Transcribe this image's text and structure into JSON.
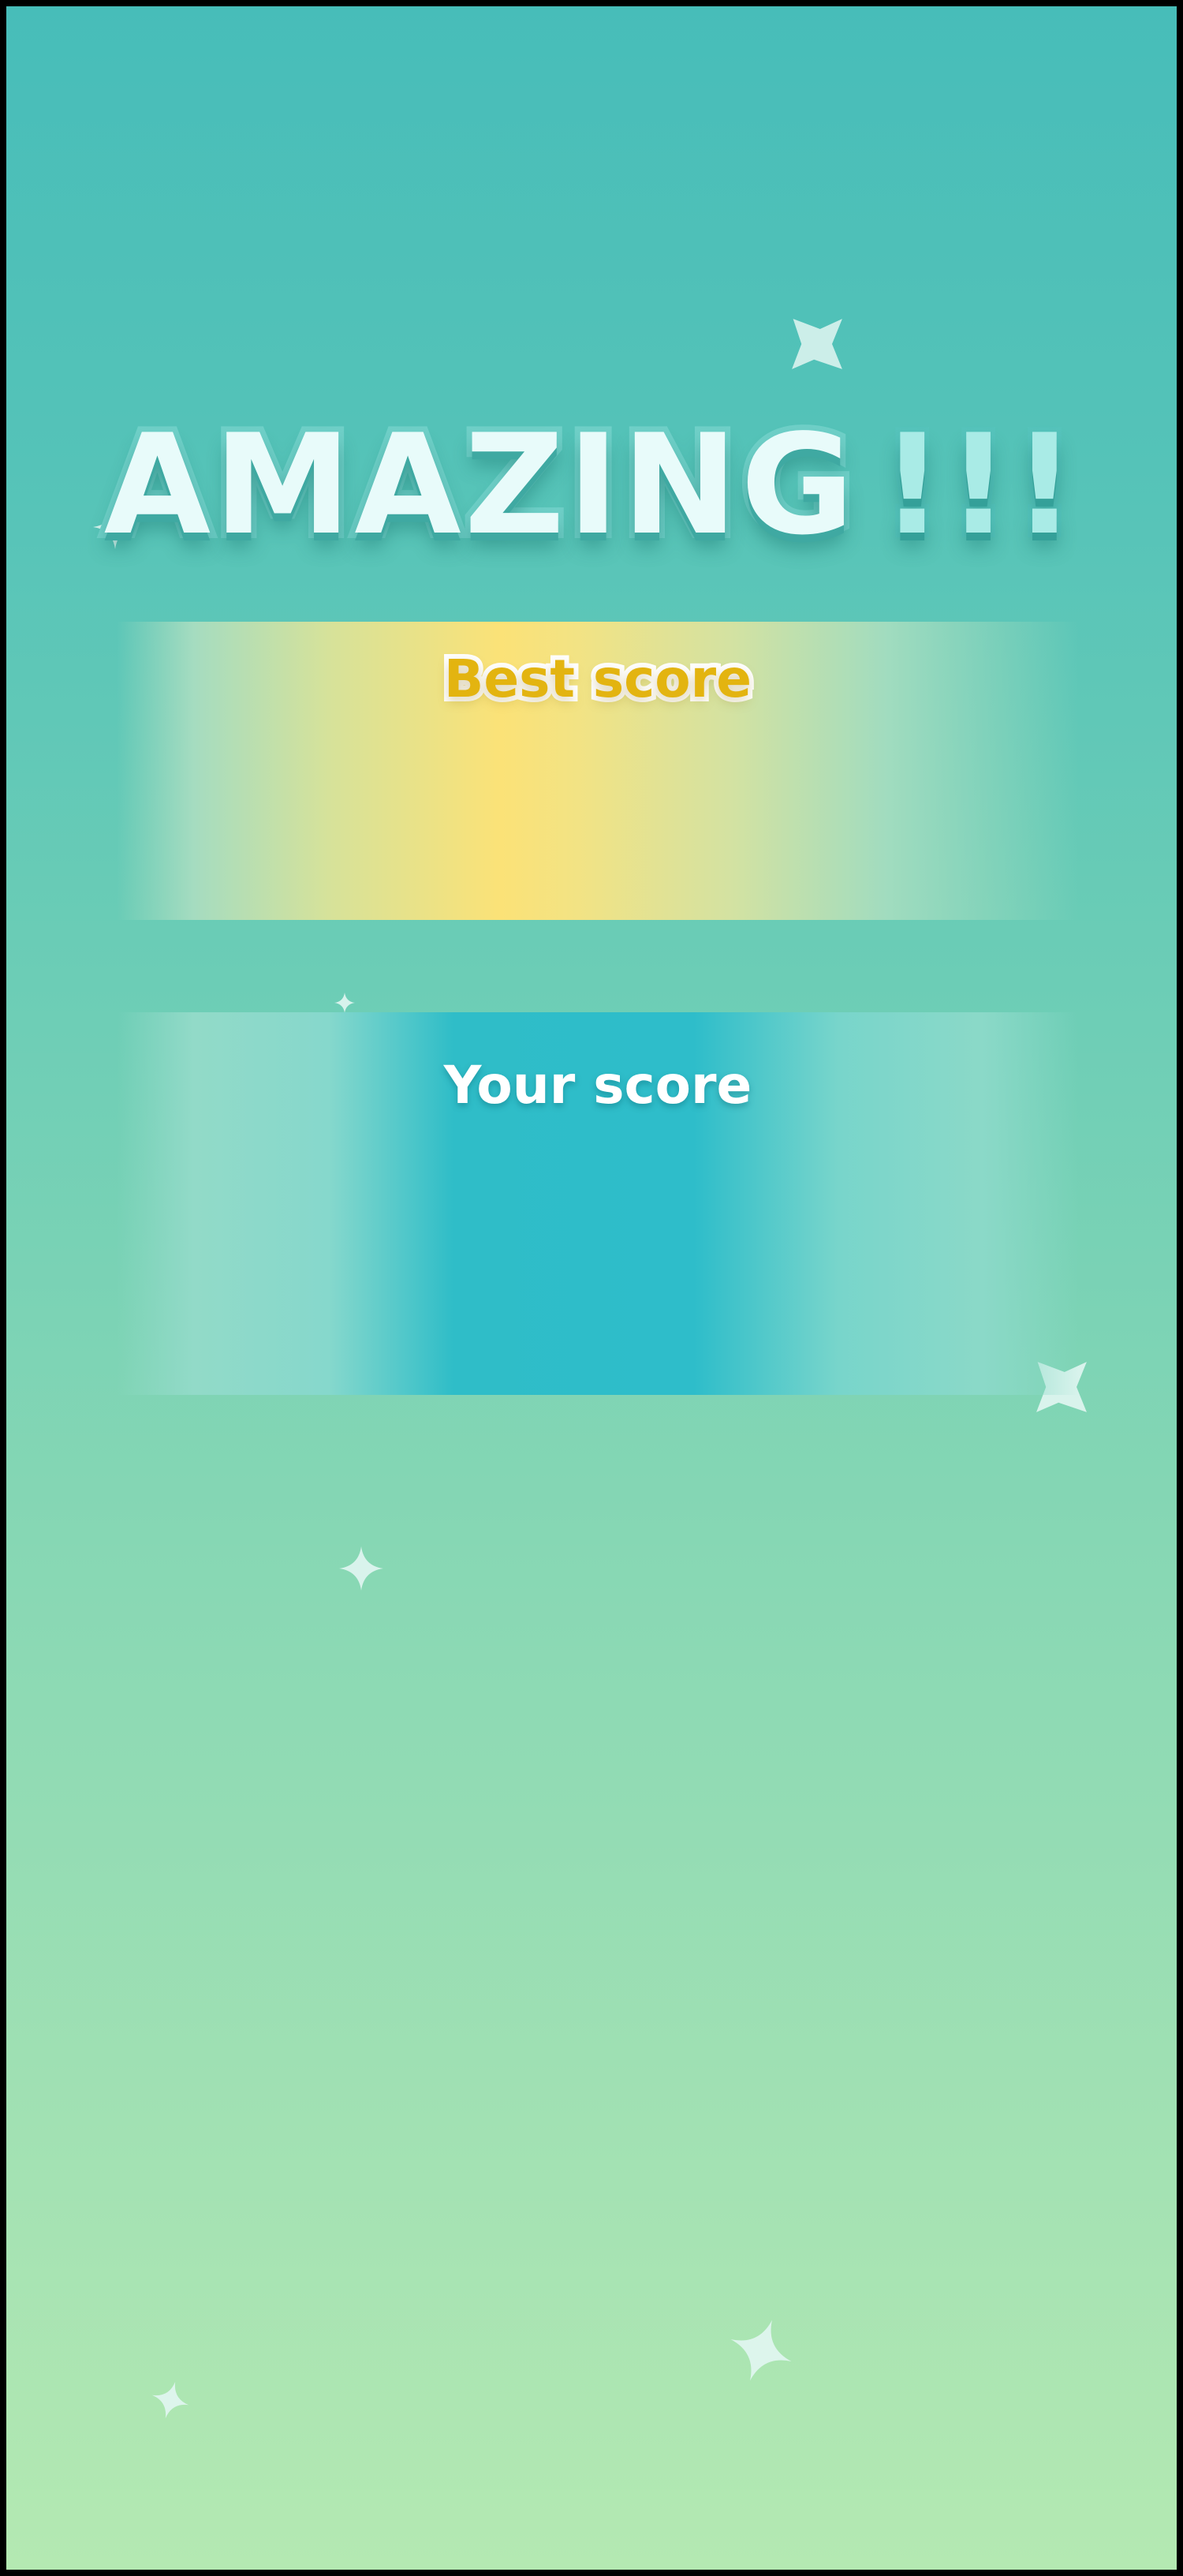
{
  "title": {
    "word": "AMAZING",
    "bangs": "!!!"
  },
  "best": {
    "label": "Best score",
    "value": ""
  },
  "your": {
    "label": "Your score",
    "value": ""
  },
  "colors": {
    "bg_top": "#47bdb9",
    "bg_bottom": "#b4e9b2",
    "best_label": "#e3b410",
    "best_panel_center": "#fbe277",
    "your_panel_center": "#2ebdca",
    "title_fill": "#e8fbfa",
    "sparkle": "#e2f6f2"
  },
  "icons": [
    "sparkle-icon"
  ]
}
